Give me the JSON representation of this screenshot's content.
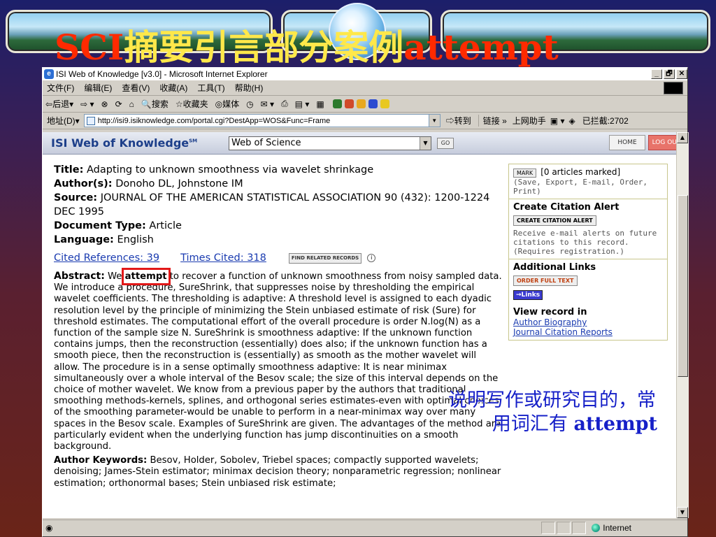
{
  "slide": {
    "title_part1": "SCI",
    "title_part2": "摘要引言部分案例",
    "title_part3": "attempt"
  },
  "window": {
    "title": "ISI Web of Knowledge [v3.0] - Microsoft Internet Explorer",
    "controls": [
      "_",
      "🗗",
      "✕"
    ]
  },
  "menubar": [
    "文件(F)",
    "编辑(E)",
    "查看(V)",
    "收藏(A)",
    "工具(T)",
    "帮助(H)"
  ],
  "toolbar": {
    "back": "后退",
    "search": "搜索",
    "favorites": "收藏夹",
    "media": "媒体"
  },
  "addressbar": {
    "label": "地址(D)",
    "url": "http://isi9.isiknowledge.com/portal.cgi?DestApp=WOS&Func=Frame",
    "go": "转到",
    "links": "链接",
    "helper": "上网助手",
    "blocked": "已拦截:2702"
  },
  "isi": {
    "logo": "ISI Web of Knowledge",
    "logo_sup": "SM",
    "database": "Web of Science",
    "go": "GO",
    "home": "HOME",
    "logout": "LOG OUT"
  },
  "record": {
    "title_label": "Title:",
    "title": "Adapting to unknown smoothness via wavelet shrinkage",
    "authors_label": "Author(s):",
    "authors": "Donoho DL, Johnstone IM",
    "source_label": "Source:",
    "source": "JOURNAL OF THE AMERICAN STATISTICAL ASSOCIATION 90 (432): 1200-1224 DEC 1995",
    "doctype_label": "Document Type:",
    "doctype": "Article",
    "language_label": "Language:",
    "language": "English",
    "cited_refs": "Cited References: 39",
    "times_cited": "Times Cited: 318",
    "find_related": "FIND RELATED RECORDS",
    "abstract_label": "Abstract:",
    "abstract_pre": "We",
    "abstract_keyword": "attempt",
    "abstract_post": "to recover a function of unknown smoothness from noisy sampled data. We introduce a procedure, SureShrink, that suppresses noise by thresholding the empirical wavelet coefficients. The thresholding is adaptive: A threshold level is assigned to each dyadic resolution level by the principle of minimizing the Stein unbiased estimate of risk (Sure) for threshold estimates. The computational effort of the overall procedure is order N.log(N) as a function of the sample size N. SureShrink is smoothness adaptive: If the unknown function contains jumps, then the reconstruction (essentially) does also; if the unknown function has a smooth piece, then the reconstruction is (essentially) as smooth as the mother wavelet will allow. The procedure is in a sense optimally smoothness adaptive: It is near minimax simultaneously over a whole interval of the Besov scale; the size of this interval depends on the choice of mother wavelet. We know from a previous paper by the authors that traditional smoothing methods-kernels, splines, and orthogonal series estimates-even with optimal choices of the smoothing parameter-would be unable to perform in a near-minimax way over many spaces in the Besov scale. Examples of SureShrink are given. The advantages of the method are particularly evident when the underlying function has jump discontinuities on a smooth background.",
    "keywords_label": "Author Keywords:",
    "keywords": "Besov, Holder, Sobolev, Triebel spaces; compactly supported wavelets; denoising; James-Stein estimator; minimax decision theory; nonparametric regression; nonlinear estimation; orthonormal bases; Stein unbiased risk estimate;"
  },
  "sidebar": {
    "mark": "MARK",
    "marked": "[0 articles marked]",
    "mark_hint": "(Save, Export, E-mail, Order, Print)",
    "alert_head": "Create Citation Alert",
    "alert_btn": "CREATE CITATION ALERT",
    "alert_text": "Receive e-mail alerts on future citations to this record. (Requires registration.)",
    "links_head": "Additional Links",
    "order_btn": "ORDER FULL TEXT",
    "links_btn": "→Links",
    "view_head": "View record in",
    "author_bio": "Author Biography",
    "jcr": "Journal Citation Reports"
  },
  "status": {
    "zone": "Internet"
  },
  "callout": {
    "line1": "说明写作或研究目的，常",
    "line2": "用词汇有",
    "keyword": "attempt"
  }
}
